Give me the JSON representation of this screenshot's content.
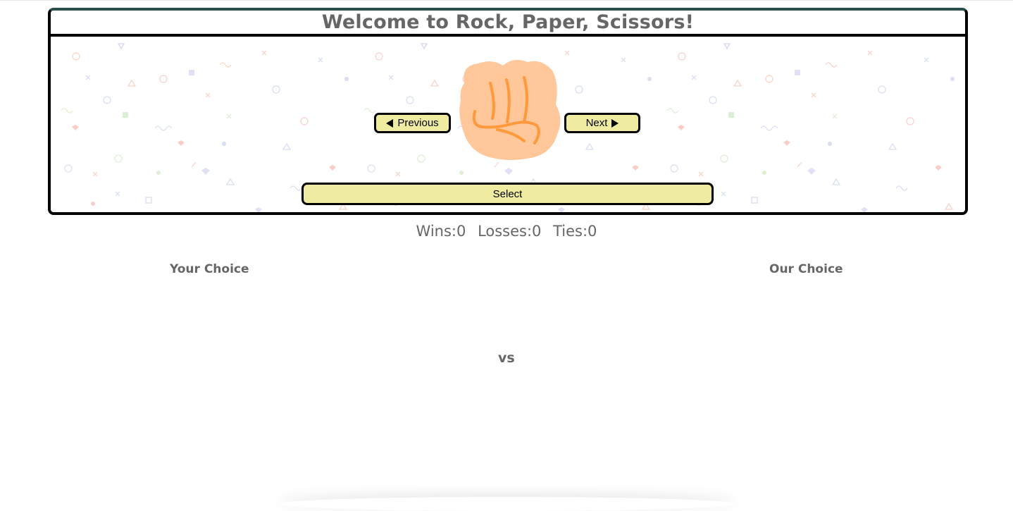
{
  "header": {
    "title": "Welcome to Rock, Paper, Scissors!"
  },
  "carousel": {
    "previous_label": "Previous",
    "next_label": "Next",
    "select_label": "Select",
    "current_choice_icon": "rock-fist-icon"
  },
  "score": {
    "wins": "Wins:0",
    "losses": "Losses:0",
    "ties": "Ties:0"
  },
  "result": {
    "your_choice_label": "Your Choice",
    "our_choice_label": "Our Choice",
    "vs_label": "vs"
  },
  "colors": {
    "button_fill": "#efeca2",
    "frame_border": "#000000",
    "text_gray": "#666666",
    "fist_fill": "#ffc79a",
    "fist_lines": "#ff9a3c"
  }
}
